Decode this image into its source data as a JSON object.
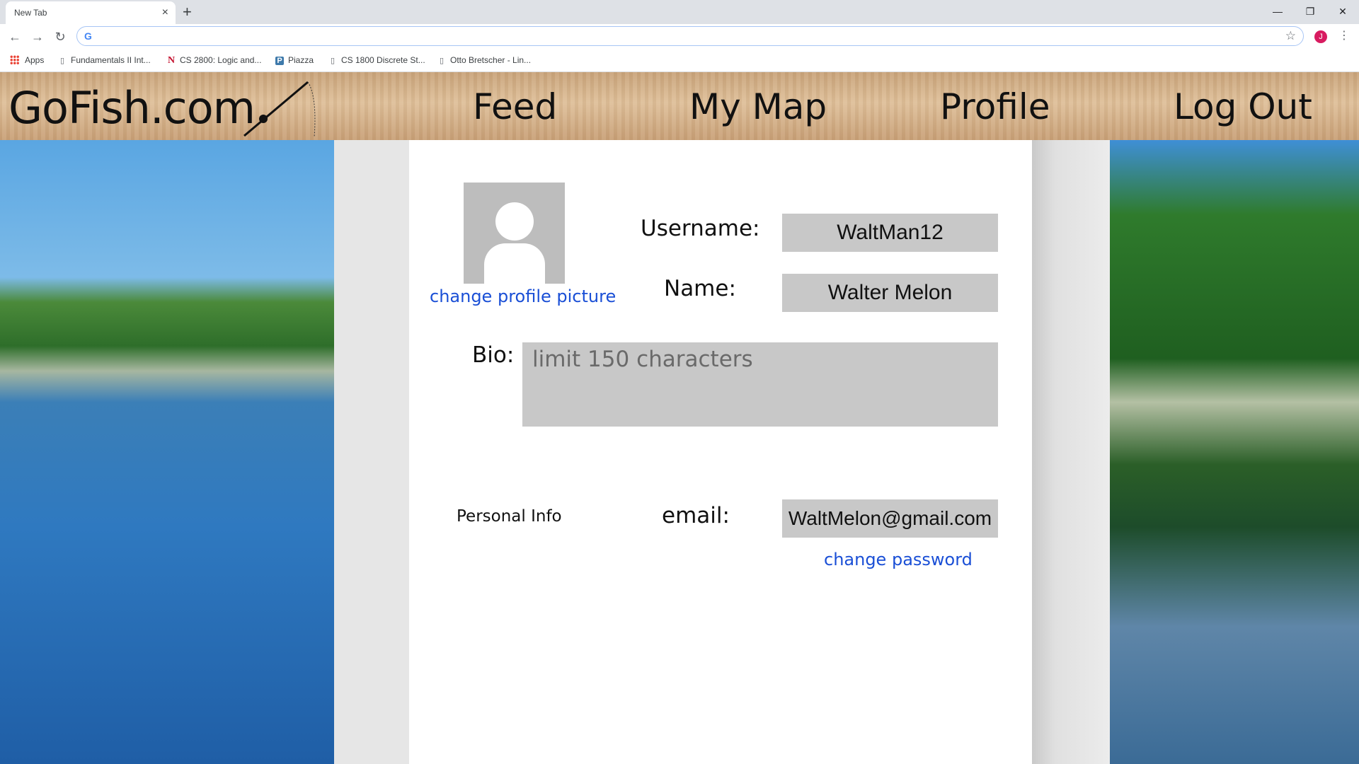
{
  "browser": {
    "tab_title": "New Tab",
    "tab_close": "×",
    "new_tab": "+",
    "window_controls": [
      "—",
      "❐",
      "✕"
    ],
    "address_value": "",
    "profile_initial": "J",
    "bookmarks": [
      {
        "label": "Apps",
        "icon": "apps-grid-icon"
      },
      {
        "label": "Fundamentals II Int...",
        "icon": "page-icon"
      },
      {
        "label": "CS 2800: Logic and...",
        "icon": "n-logo-icon"
      },
      {
        "label": "Piazza",
        "icon": "piazza-icon"
      },
      {
        "label": "CS 1800 Discrete St...",
        "icon": "page-icon"
      },
      {
        "label": "Otto Bretscher - Lin...",
        "icon": "page-icon"
      }
    ]
  },
  "header": {
    "brand": "GoFish.com",
    "nav": [
      "Feed",
      "My Map",
      "Profile",
      "Log Out"
    ]
  },
  "profile": {
    "change_picture": "change profile picture",
    "username_label": "Username:",
    "username_value": "WaltMan12",
    "name_label": "Name:",
    "name_value": "Walter Melon",
    "bio_label": "Bio:",
    "bio_placeholder": "limit 150 characters",
    "personal_info": "Personal Info",
    "email_label": "email:",
    "email_value": "WaltMelon@gmail.com",
    "change_password": "change password"
  },
  "colors": {
    "link": "#1a4fd6",
    "field_bg": "#c8c8c8",
    "header_wood": "#d6b48c"
  }
}
